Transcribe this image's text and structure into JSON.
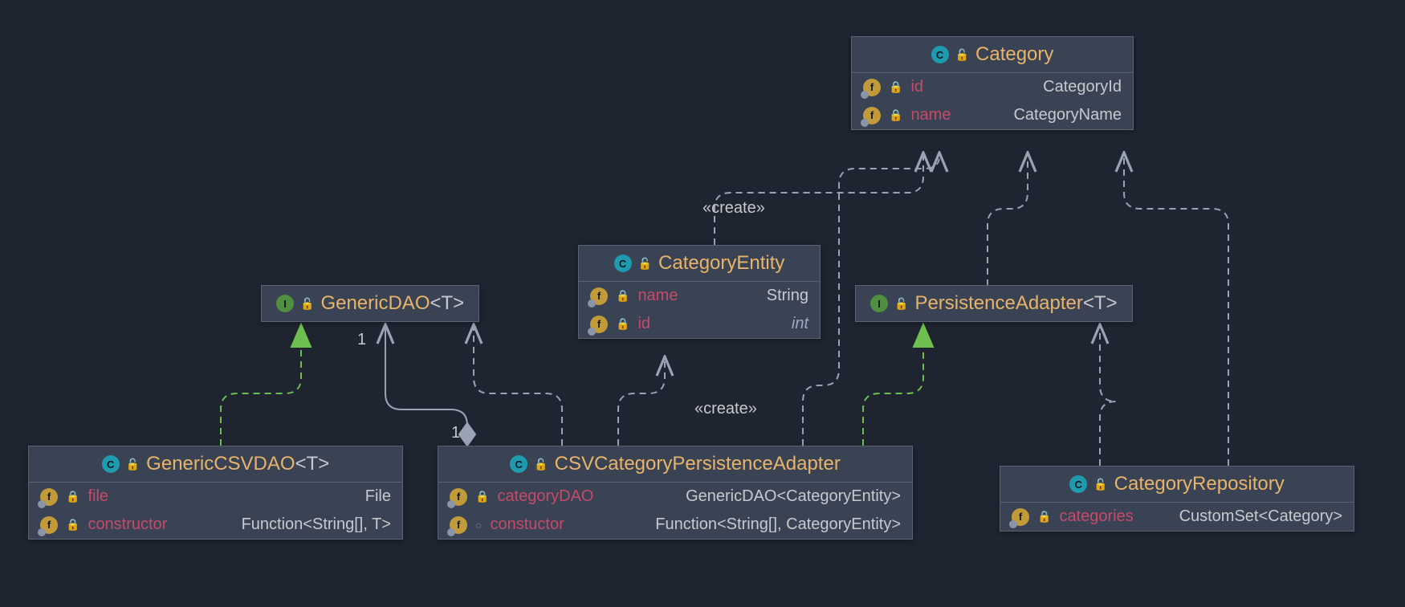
{
  "nodes": {
    "category": {
      "kind": "class",
      "title": "Category",
      "members": [
        {
          "icon": "field",
          "vis": "locked",
          "name": "id",
          "type": "CategoryId"
        },
        {
          "icon": "field",
          "vis": "locked",
          "name": "name",
          "type": "CategoryName"
        }
      ]
    },
    "categoryEntity": {
      "kind": "class",
      "title": "CategoryEntity",
      "members": [
        {
          "icon": "field",
          "vis": "locked",
          "name": "name",
          "type": "String"
        },
        {
          "icon": "field",
          "vis": "locked",
          "name": "id",
          "type": "int",
          "italic": true
        }
      ]
    },
    "genericDAO": {
      "kind": "interface",
      "title": "GenericDAO",
      "generic": "<T>",
      "members": []
    },
    "persistenceAdapter": {
      "kind": "interface",
      "title": "PersistenceAdapter",
      "generic": "<T>",
      "members": []
    },
    "genericCSVDAO": {
      "kind": "class",
      "title": "GenericCSVDAO",
      "generic": "<T>",
      "members": [
        {
          "icon": "field",
          "vis": "locked",
          "name": "file",
          "type": "File"
        },
        {
          "icon": "field",
          "vis": "locked",
          "name": "constructor",
          "type": "Function<String[], T>"
        }
      ]
    },
    "csvCategoryPersistenceAdapter": {
      "kind": "class",
      "title": "CSVCategoryPersistenceAdapter",
      "members": [
        {
          "icon": "field",
          "vis": "locked",
          "name": "categoryDAO",
          "type": "GenericDAO<CategoryEntity>"
        },
        {
          "icon": "field",
          "vis": "open",
          "name": "constuctor",
          "type": "Function<String[], CategoryEntity>"
        }
      ]
    },
    "categoryRepository": {
      "kind": "class",
      "title": "CategoryRepository",
      "members": [
        {
          "icon": "field",
          "vis": "locked",
          "name": "categories",
          "type": "CustomSet<Category>"
        }
      ]
    }
  },
  "labels": {
    "create1": "«create»",
    "create2": "«create»",
    "mult1": "1",
    "mult2": "1"
  },
  "relationships": [
    {
      "from": "GenericCSVDAO",
      "to": "GenericDAO",
      "type": "realization"
    },
    {
      "from": "CSVCategoryPersistenceAdapter",
      "to": "PersistenceAdapter",
      "type": "realization"
    },
    {
      "from": "CSVCategoryPersistenceAdapter",
      "to": "GenericDAO",
      "type": "aggregation",
      "mult_from": "1",
      "mult_to": "1"
    },
    {
      "from": "CSVCategoryPersistenceAdapter",
      "to": "CategoryEntity",
      "type": "dependency",
      "stereotype": "«create»"
    },
    {
      "from": "CSVCategoryPersistenceAdapter",
      "to": "CategoryEntity",
      "type": "dependency"
    },
    {
      "from": "CSVCategoryPersistenceAdapter",
      "to": "Category",
      "type": "dependency"
    },
    {
      "from": "CategoryEntity",
      "to": "Category",
      "type": "dependency",
      "stereotype": "«create»"
    },
    {
      "from": "CategoryRepository",
      "to": "PersistenceAdapter",
      "type": "dependency"
    },
    {
      "from": "CategoryRepository",
      "to": "Category",
      "type": "dependency"
    },
    {
      "from": "PersistenceAdapter",
      "to": "Category",
      "type": "dependency"
    }
  ]
}
